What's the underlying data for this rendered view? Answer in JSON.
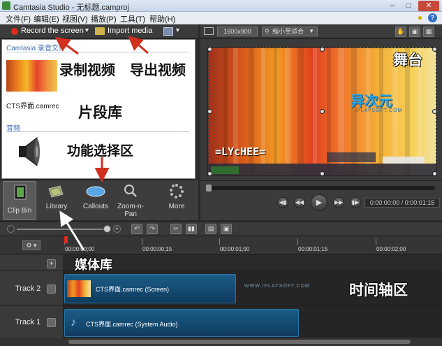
{
  "window": {
    "title": "Camtasia Studio - 无标题.camproj"
  },
  "menu": [
    "文件(F)",
    "编辑(E)",
    "视图(V)",
    "播放(P)",
    "工具(T)",
    "帮助(H)"
  ],
  "left_toolbar": {
    "record": "Record the screen",
    "import": "Import media"
  },
  "clip_bin": {
    "section_video": "Camtasia 录音文件",
    "video_clip": "CTS界面.camrec",
    "section_audio": "音频"
  },
  "tabs": [
    "Clip Bin",
    "Library",
    "Callouts",
    "Zoom-n-Pan",
    "More"
  ],
  "tab_zoom_line2": "Pan",
  "tab_zoom_line1": "Zoom-n-",
  "preview_toolbar": {
    "size": "1600x900",
    "zoom": "缩小至适合"
  },
  "canvas": {
    "logo": "异次元",
    "logo_sub": "IPLAYSOFT.COM",
    "watermark": "=LYcHEE="
  },
  "player": {
    "time": "0:00:00:00 / 0:00:01:15"
  },
  "ruler": [
    "00:00:00;00",
    "00:00:00;15",
    "00:00:01;00",
    "00:00:01;15",
    "00:00:02;00"
  ],
  "tracks": [
    {
      "name": "Track 2",
      "clip": "CTS界面.camrec (Screen)"
    },
    {
      "name": "Track 1",
      "clip": "CTS界面.camrec (System Audio)"
    }
  ],
  "timeline_watermark": "WWW.IPLAYSOFT.COM",
  "annotations": {
    "record": "录制视频",
    "export": "导出视频",
    "stage": "舞台",
    "clip_library": "片段库",
    "function_select": "功能选择区",
    "media_library": "媒体库",
    "timeline": "时间轴区"
  }
}
